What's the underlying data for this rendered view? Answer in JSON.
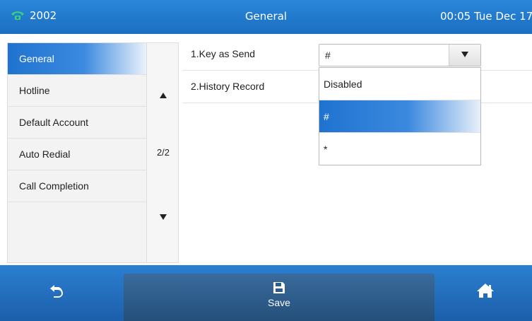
{
  "status_bar": {
    "account": "2002",
    "title": "General",
    "clock": "00:05 Tue Dec 17"
  },
  "sidebar": {
    "items": [
      {
        "label": "General",
        "active": true
      },
      {
        "label": "Hotline",
        "active": false
      },
      {
        "label": "Default Account",
        "active": false
      },
      {
        "label": "Auto Redial",
        "active": false
      },
      {
        "label": "Call Completion",
        "active": false
      }
    ]
  },
  "pager": {
    "up_icon": "up-arrow",
    "page": "2/2",
    "down_icon": "down-arrow"
  },
  "settings": [
    {
      "label": "1.Key as Send",
      "value": "#"
    },
    {
      "label": "2.History Record"
    }
  ],
  "dropdown": {
    "options": [
      "Disabled",
      "#",
      "*"
    ],
    "selected": "#"
  },
  "softkeys": {
    "back_icon": "back-icon",
    "save_label": "Save",
    "save_icon": "floppy-disk-icon",
    "home_icon": "home-icon"
  },
  "colors": {
    "accent": "#1f73cf",
    "topbar": "#2a86d9",
    "bottombar": "#1c5fab"
  }
}
